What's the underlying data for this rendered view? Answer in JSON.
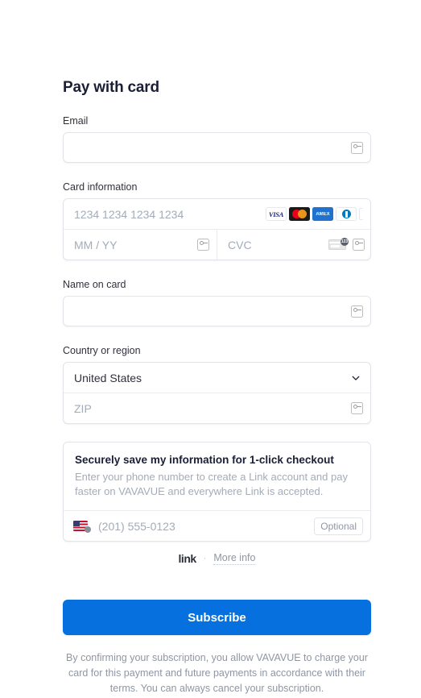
{
  "page": {
    "title": "Pay with card"
  },
  "email": {
    "label": "Email",
    "value": "",
    "placeholder": "",
    "autofill_icon": "autofill-key-icon"
  },
  "card": {
    "label": "Card information",
    "number_placeholder": "1234 1234 1234 1234",
    "number_value": "",
    "expiry_placeholder": "MM / YY",
    "expiry_value": "",
    "cvc_placeholder": "CVC",
    "cvc_value": "",
    "brands": [
      {
        "name": "visa",
        "text": "VISA"
      },
      {
        "name": "mastercard",
        "text": ""
      },
      {
        "name": "amex",
        "text": "AMEX"
      },
      {
        "name": "diners-club",
        "text": ""
      }
    ],
    "cvc_hint_icon": "cvc-card-icon"
  },
  "name_on_card": {
    "label": "Name on card",
    "value": "",
    "placeholder": ""
  },
  "country": {
    "label": "Country or region",
    "selected": "United States",
    "zip_placeholder": "ZIP",
    "zip_value": "",
    "chevron_icon": "chevron-down-icon"
  },
  "link_box": {
    "title": "Securely save my information for 1-click checkout",
    "description": "Enter your phone number to create a Link account and pay faster on VAVAVUE and everywhere Link is accepted.",
    "phone_placeholder": "(201) 555-0123",
    "phone_value": "",
    "country_flag": "us-flag-icon",
    "optional_badge": "Optional",
    "wordmark": "link",
    "separator": "·",
    "more_info": "More info"
  },
  "submit": {
    "label": "Subscribe"
  },
  "legal": {
    "text": "By confirming your subscription, you allow VAVAVUE to charge your card for this payment and future payments in accordance with their terms. You can always cancel your subscription."
  },
  "colors": {
    "accent": "#0570DE",
    "text": "#30313D",
    "muted": "#A3ACB9",
    "border": "#E2E4E9"
  }
}
